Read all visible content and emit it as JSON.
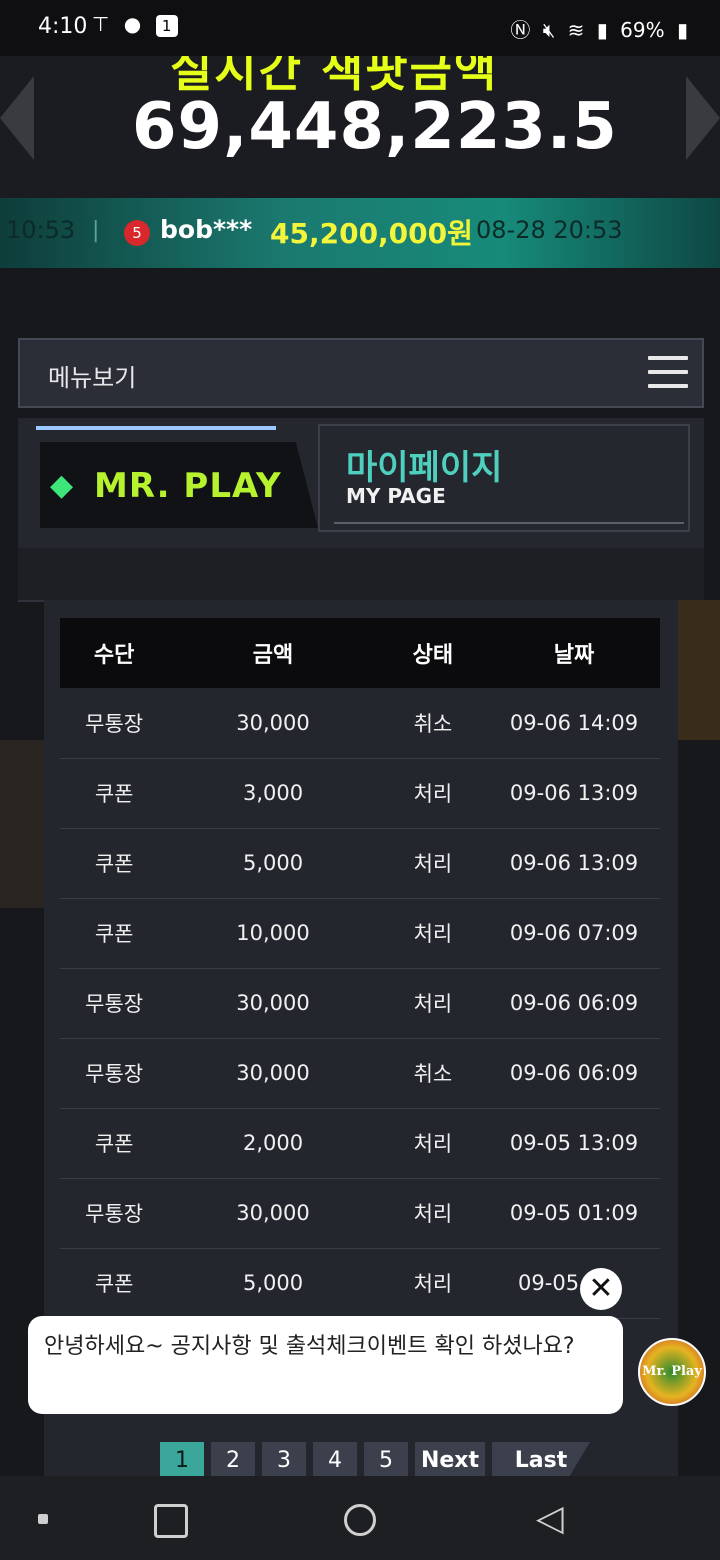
{
  "status_bar": {
    "time": "4:10",
    "notif_icons": [
      "T-icon",
      "chat-bubble-icon",
      "notification-badge-icon"
    ],
    "notif_badge": "1",
    "battery": "69%"
  },
  "jackpot": {
    "title": "실시간 잭팟금액",
    "amount": "69,448,223.5"
  },
  "ticker": {
    "prev_time": "10:53",
    "separator": "|",
    "level": "5",
    "user": "bob***",
    "amount": "45,200,000원",
    "datetime": "08-28 20:53"
  },
  "menu": {
    "label": "메뉴보기"
  },
  "header": {
    "brand": "MR. PLAY",
    "title_kr": "마이페이지",
    "title_en": "MY PAGE"
  },
  "table": {
    "headers": [
      "수단",
      "금액",
      "상태",
      "날짜"
    ],
    "rows": [
      [
        "무통장",
        "30,000",
        "취소",
        "09-06 14:09"
      ],
      [
        "쿠폰",
        "3,000",
        "처리",
        "09-06 13:09"
      ],
      [
        "쿠폰",
        "5,000",
        "처리",
        "09-06 13:09"
      ],
      [
        "쿠폰",
        "10,000",
        "처리",
        "09-06 07:09"
      ],
      [
        "무통장",
        "30,000",
        "처리",
        "09-06 06:09"
      ],
      [
        "무통장",
        "30,000",
        "취소",
        "09-06 06:09"
      ],
      [
        "쿠폰",
        "2,000",
        "처리",
        "09-05 13:09"
      ],
      [
        "무통장",
        "30,000",
        "처리",
        "09-05 01:09"
      ],
      [
        "쿠폰",
        "5,000",
        "처리",
        "09-05 0"
      ]
    ]
  },
  "pagination": {
    "pages": [
      "1",
      "2",
      "3",
      "4",
      "5"
    ],
    "next": "Next",
    "last": "Last",
    "active": "1"
  },
  "chat": {
    "message": "안녕하세요~ 공지사항 및 출석체크이벤트 확인 하셨나요?",
    "avatar_text": "Mr. Play"
  },
  "colors": {
    "accent_teal": "#3aa79a",
    "brand_green": "#b6f22e",
    "jackpot_yellow": "#e6ff18"
  }
}
